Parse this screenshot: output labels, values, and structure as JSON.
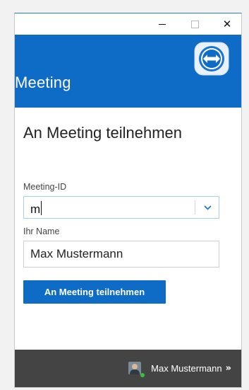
{
  "window": {
    "minimize_icon": "minimize-icon",
    "maximize_icon": "maximize-icon",
    "close_icon": "close-icon",
    "close_glyph": "✕"
  },
  "header": {
    "title": "Meeting",
    "logo_icon": "teamviewer-logo-icon",
    "accent_color": "#0e6bc6"
  },
  "form": {
    "heading": "An Meeting teilnehmen",
    "meeting_id_label": "Meeting-ID",
    "meeting_id_value": "m",
    "name_label": "Ihr Name",
    "name_value": "Max Mustermann",
    "submit_label": "An Meeting teilnehmen"
  },
  "footer": {
    "user_name": "Max Mustermann",
    "chevron": "»",
    "status_color": "#38c23a",
    "background_color": "#444444"
  }
}
